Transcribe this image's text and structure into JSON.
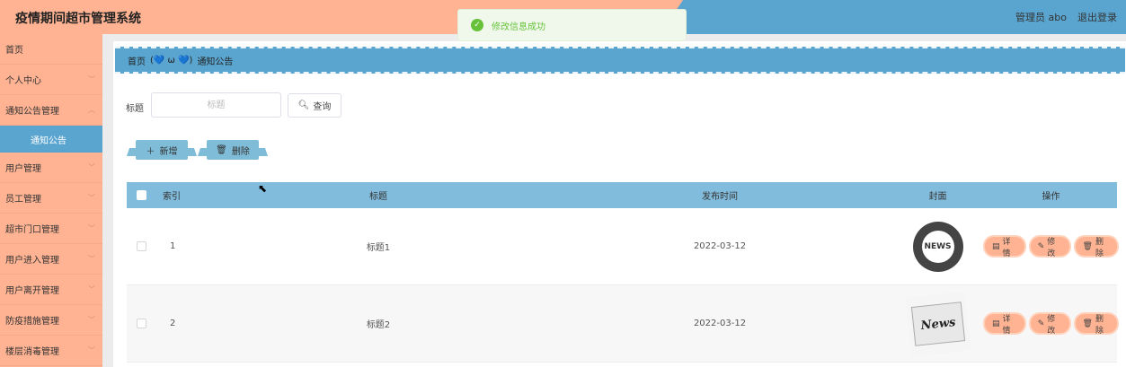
{
  "header": {
    "title": "疫情期间超市管理系统",
    "user_label": "管理员 abo",
    "logout_label": "退出登录"
  },
  "toast": {
    "message": "修改信息成功"
  },
  "sidebar": {
    "items": [
      {
        "label": "首页"
      },
      {
        "label": "个人中心"
      },
      {
        "label": "通知公告管理"
      },
      {
        "label": "通知公告"
      },
      {
        "label": "用户管理"
      },
      {
        "label": "员工管理"
      },
      {
        "label": "超市门口管理"
      },
      {
        "label": "用户进入管理"
      },
      {
        "label": "用户离开管理"
      },
      {
        "label": "防疫措施管理"
      },
      {
        "label": "楼层消毒管理"
      }
    ]
  },
  "breadcrumb": {
    "home": "首页",
    "face": "(💙 ω 💙)",
    "current": "通知公告"
  },
  "search": {
    "label": "标题",
    "placeholder": "标题",
    "button": "查询"
  },
  "actions": {
    "add": "新增",
    "delete": "删除"
  },
  "table": {
    "columns": [
      "索引",
      "标题",
      "发布时间",
      "封面",
      "操作"
    ],
    "rows": [
      {
        "index": "1",
        "title": "标题1",
        "time": "2022-03-12",
        "cover": "NEWS"
      },
      {
        "index": "2",
        "title": "标题2",
        "time": "2022-03-12",
        "cover": "News"
      }
    ],
    "ops": {
      "detail": "详情",
      "edit": "修改",
      "delete": "删除"
    }
  },
  "colors": {
    "peach": "#ffb393",
    "blue": "#5aa5cf",
    "table_header": "#82bcdc",
    "success": "#67c23a"
  }
}
